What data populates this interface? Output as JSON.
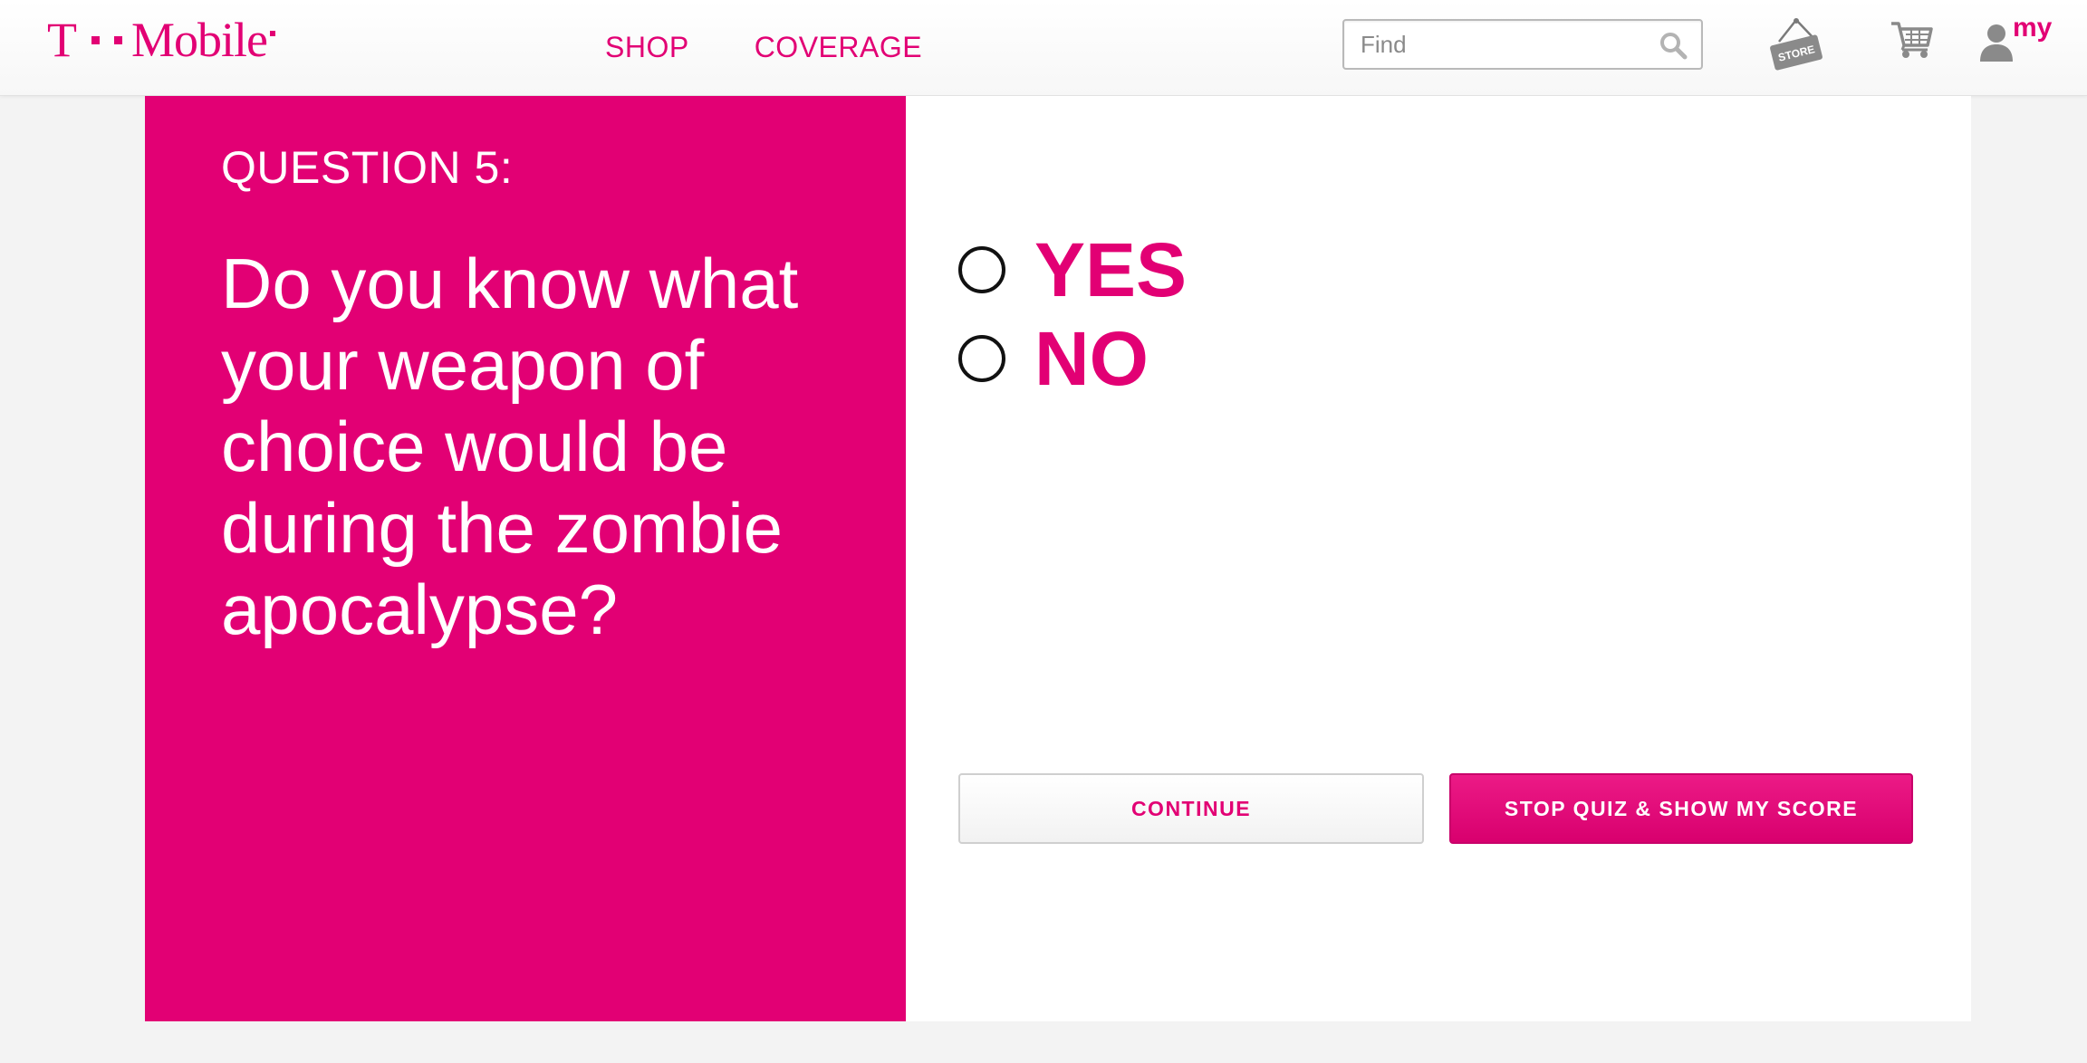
{
  "brand": {
    "name_t": "T",
    "name_word": "Mobile",
    "color": "#e20074"
  },
  "nav": {
    "items": [
      {
        "label": "SHOP"
      },
      {
        "label": "COVERAGE"
      }
    ]
  },
  "search": {
    "placeholder": "Find",
    "value": "",
    "icon": "search-icon"
  },
  "header_icons": {
    "store_label": "STORE",
    "store_icon": "store-sign-icon",
    "cart_icon": "shopping-cart-icon",
    "account_label": "my",
    "account_icon": "person-icon"
  },
  "quiz": {
    "question_label": "QUESTION 5:",
    "question_text": "Do you know what your weapon of choice would be during the zombie apocalypse?",
    "options": [
      {
        "label": "YES",
        "selected": false
      },
      {
        "label": "NO",
        "selected": false
      }
    ],
    "continue_label": "CONTINUE",
    "stop_label": "STOP QUIZ & SHOW MY SCORE"
  },
  "colors": {
    "accent": "#e20074",
    "background": "#f3f3f3",
    "card": "#ffffff"
  }
}
